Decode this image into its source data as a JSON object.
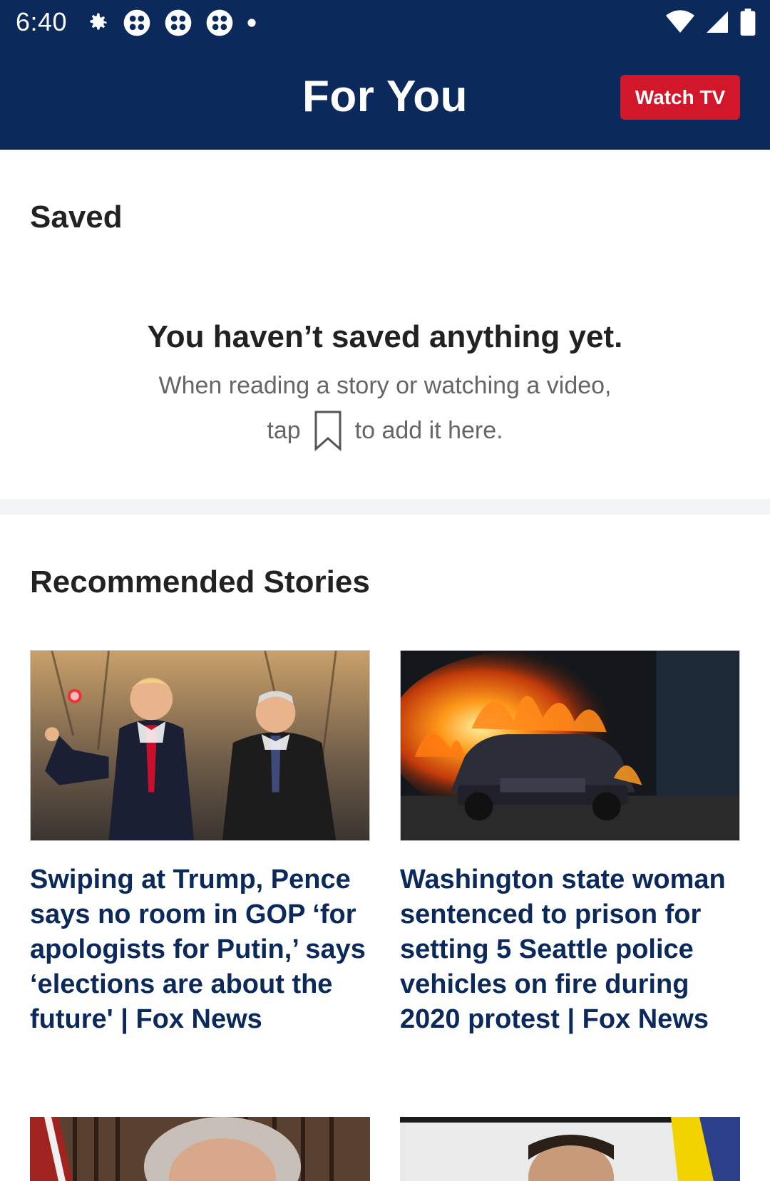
{
  "status_bar": {
    "time": "6:40",
    "left_icons": [
      "settings-gear-icon",
      "app-notification-icon",
      "app-notification-icon",
      "app-notification-icon",
      "dot-icon"
    ],
    "right_icons": [
      "wifi-icon",
      "cell-signal-icon",
      "battery-icon"
    ]
  },
  "header": {
    "title": "For You",
    "watch_tv_label": "Watch TV"
  },
  "saved": {
    "title": "Saved",
    "empty_title": "You haven’t saved anything yet.",
    "empty_line1": "When reading a story or watching a video,",
    "empty_line2_before": "tap",
    "empty_line2_after": "to add it here.",
    "bookmark_icon": "bookmark-icon"
  },
  "recommended": {
    "title": "Recommended Stories",
    "stories": [
      {
        "headline": "Swiping at Trump, Pence says no room in GOP ‘for apologists for Putin,’ says ‘elections are about the future' | Fox News"
      },
      {
        "headline": "Washington state woman sentenced to prison for setting 5 Seattle police vehicles on fire during 2020 protest | Fox News"
      }
    ]
  },
  "colors": {
    "navy": "#0b2a5b",
    "red": "#d3172a",
    "divider": "#f2f3f5"
  }
}
